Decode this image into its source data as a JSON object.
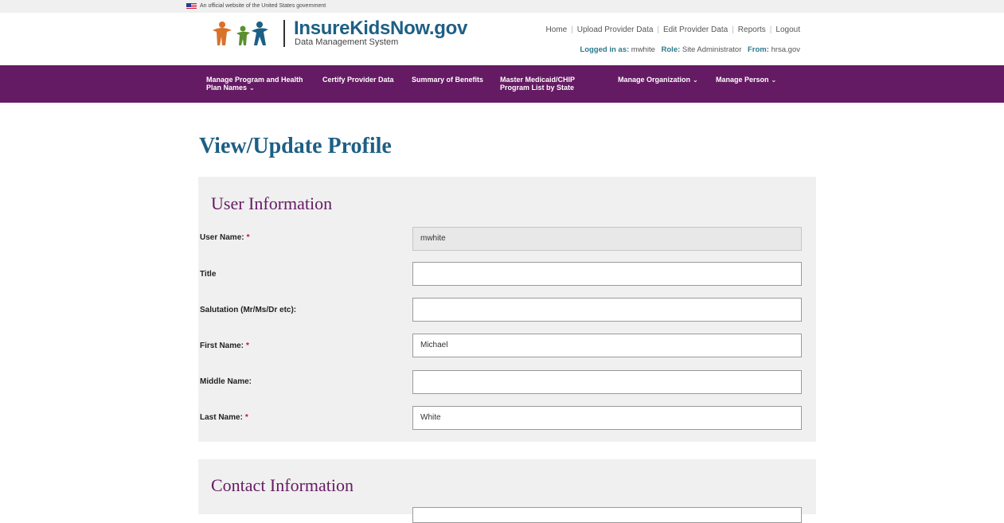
{
  "gov_banner": {
    "text": "An official website of the United States government"
  },
  "brand": {
    "name": "InsureKidsNow.gov",
    "subtitle": "Data Management System",
    "icon": "people-family-icon"
  },
  "top_links": [
    {
      "label": "Home"
    },
    {
      "label": "Upload Provider Data"
    },
    {
      "label": "Edit Provider Data"
    },
    {
      "label": "Reports"
    },
    {
      "label": "Logout"
    }
  ],
  "login": {
    "user_label": "Logged in as:",
    "user": "mwhite",
    "role_label": "Role:",
    "role": "Site Administrator",
    "from_label": "From:",
    "from": "hrsa.gov"
  },
  "nav": {
    "items": [
      {
        "line1": "Manage Program and Health",
        "line2": "Plan Names",
        "dropdown": true
      },
      {
        "line1": "Certify Provider Data",
        "line2": "",
        "dropdown": false
      },
      {
        "line1": "Summary of Benefits",
        "line2": "",
        "dropdown": false
      },
      {
        "line1": "Master Medicaid/CHIP",
        "line2": "Program List by State",
        "dropdown": false
      },
      {
        "line1": "Manage Organization",
        "line2": "",
        "dropdown": true
      },
      {
        "line1": "Manage Person",
        "line2": "",
        "dropdown": true
      }
    ]
  },
  "page": {
    "title": "View/Update Profile"
  },
  "user_info": {
    "title": "User Information",
    "fields": [
      {
        "label": "User Name:",
        "required": "*",
        "value": "mwhite"
      },
      {
        "label": "Title",
        "required": "",
        "value": ""
      },
      {
        "label": "Salutation (Mr/Ms/Dr etc):",
        "required": "",
        "value": ""
      },
      {
        "label": "First Name:",
        "required": "*",
        "value": "Michael"
      },
      {
        "label": "Middle Name:",
        "required": "",
        "value": ""
      },
      {
        "label": "Last Name:",
        "required": "*",
        "value": "White"
      }
    ]
  },
  "contact_info": {
    "title": "Contact Information"
  },
  "colors": {
    "brand_purple": "#651b63",
    "brand_blue": "#1d5f85",
    "required_red": "#c8102e",
    "panel_gray": "#f0f0f0"
  }
}
